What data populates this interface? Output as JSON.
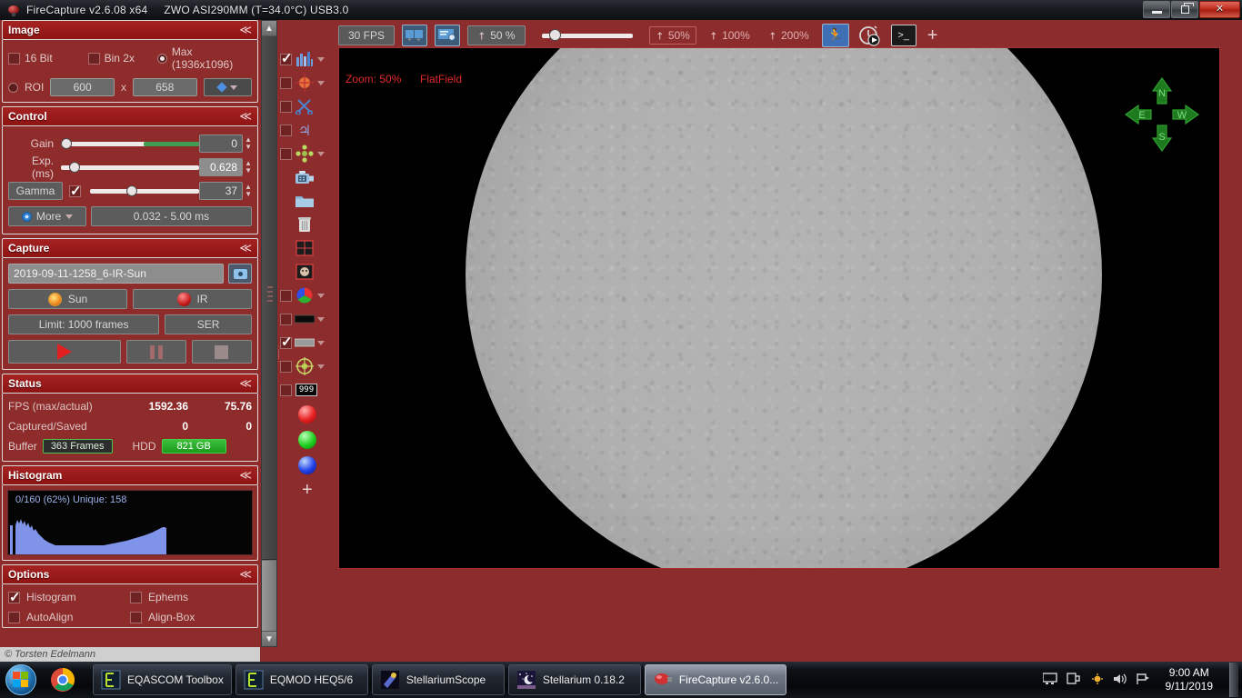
{
  "window": {
    "title": "FireCapture v2.6.08  x64",
    "camera": "ZWO ASI290MM (T=34.0°C) USB3.0",
    "minimize_label": "–",
    "restore_label": "❐",
    "close_label": "✕"
  },
  "panels": {
    "image": {
      "title": "Image",
      "collapse_glyph": "≪",
      "bit16_label": "16 Bit",
      "bin2x_label": "Bin 2x",
      "max_label": "Max (1936x1096)",
      "roi_label": "ROI",
      "roi_width": "600",
      "roi_x_label": "x",
      "roi_height": "658"
    },
    "control": {
      "title": "Control",
      "collapse_glyph": "≪",
      "gain_label": "Gain",
      "gain_value": "0",
      "exp_label": "Exp. (ms)",
      "exp_value": "0.628",
      "gamma_label": "Gamma",
      "gamma_value": "37",
      "more_label": "More",
      "exp_range": "0.032 - 5.00 ms"
    },
    "capture": {
      "title": "Capture",
      "collapse_glyph": "≪",
      "filename": "2019-09-11-1258_6-IR-Sun",
      "sun_label": "Sun",
      "ir_label": "IR",
      "limit_label": "Limit: 1000 frames",
      "format_label": "SER"
    },
    "status": {
      "title": "Status",
      "collapse_glyph": "≪",
      "fps_label": "FPS (max/actual)",
      "fps_max": "1592.36",
      "fps_actual": "75.76",
      "captured_label": "Captured/Saved",
      "captured": "0",
      "saved": "0",
      "buffer_label": "Buffer",
      "buffer_value": "363 Frames",
      "hdd_label": "HDD",
      "hdd_value": "821 GB"
    },
    "histogram": {
      "title": "Histogram",
      "collapse_glyph": "≪",
      "info": "0/160 (62%)  Unique: 158"
    },
    "options": {
      "title": "Options",
      "collapse_glyph": "≪",
      "items": [
        {
          "label": "Histogram",
          "checked": true
        },
        {
          "label": "Ephems",
          "checked": false
        },
        {
          "label": "AutoAlign",
          "checked": false
        },
        {
          "label": "Align-Box",
          "checked": false
        }
      ]
    }
  },
  "credit": "© Torsten Edelmann",
  "toolbar": {
    "fps_label": "30 FPS",
    "zoom_label": "50 %",
    "preset_50": "50%",
    "preset_100": "100%",
    "preset_200": "200%",
    "plus_label": "+",
    "terminal_glyph": ">_"
  },
  "image_overlay": {
    "zoom_text": "Zoom: 50%",
    "flatfield_text": "FlatField",
    "compass": {
      "north": "N",
      "east": "E",
      "south": "S",
      "west": "W"
    }
  },
  "vertical_tools": [
    {
      "name": "histogram-tool",
      "checked": true,
      "caret": true
    },
    {
      "name": "target-tool",
      "checked": false,
      "caret": true
    },
    {
      "name": "scissors-tool",
      "checked": false,
      "caret": false
    },
    {
      "name": "jupiter-tool",
      "checked": false,
      "caret": false
    },
    {
      "name": "align-tool",
      "checked": false,
      "caret": true
    },
    {
      "name": "film-camera-tool",
      "checked": null,
      "caret": false
    },
    {
      "name": "folder-tool",
      "checked": null,
      "caret": false
    },
    {
      "name": "trash-tool",
      "checked": null,
      "caret": false
    },
    {
      "name": "grid-tool",
      "checked": null,
      "caret": false
    },
    {
      "name": "face-tool",
      "checked": null,
      "caret": false
    },
    {
      "name": "colorwheel-tool",
      "checked": false,
      "caret": true
    },
    {
      "name": "blackbar-tool",
      "checked": false,
      "caret": true
    },
    {
      "name": "graybar-tool",
      "checked": true,
      "caret": true
    },
    {
      "name": "crosshair-tool",
      "checked": false,
      "caret": true
    },
    {
      "name": "counter-tool",
      "checked": false,
      "caret": false,
      "badge": "999"
    }
  ],
  "taskbar": {
    "items": [
      {
        "label": "EQASCOM Toolbox",
        "active": false
      },
      {
        "label": "EQMOD HEQ5/6",
        "active": false
      },
      {
        "label": "StellariumScope",
        "active": false
      },
      {
        "label": "Stellarium 0.18.2",
        "active": false
      },
      {
        "label": "FireCapture v2.6.0...",
        "active": true
      }
    ],
    "clock_time": "9:00 AM",
    "clock_date": "9/11/2019"
  },
  "colors": {
    "panel_red": "#8e2b2b",
    "header_red": "#a52222",
    "accent_green": "#3cc03c",
    "overlay_red": "#e02a2a",
    "histogram_blue": "#7f94e8"
  }
}
